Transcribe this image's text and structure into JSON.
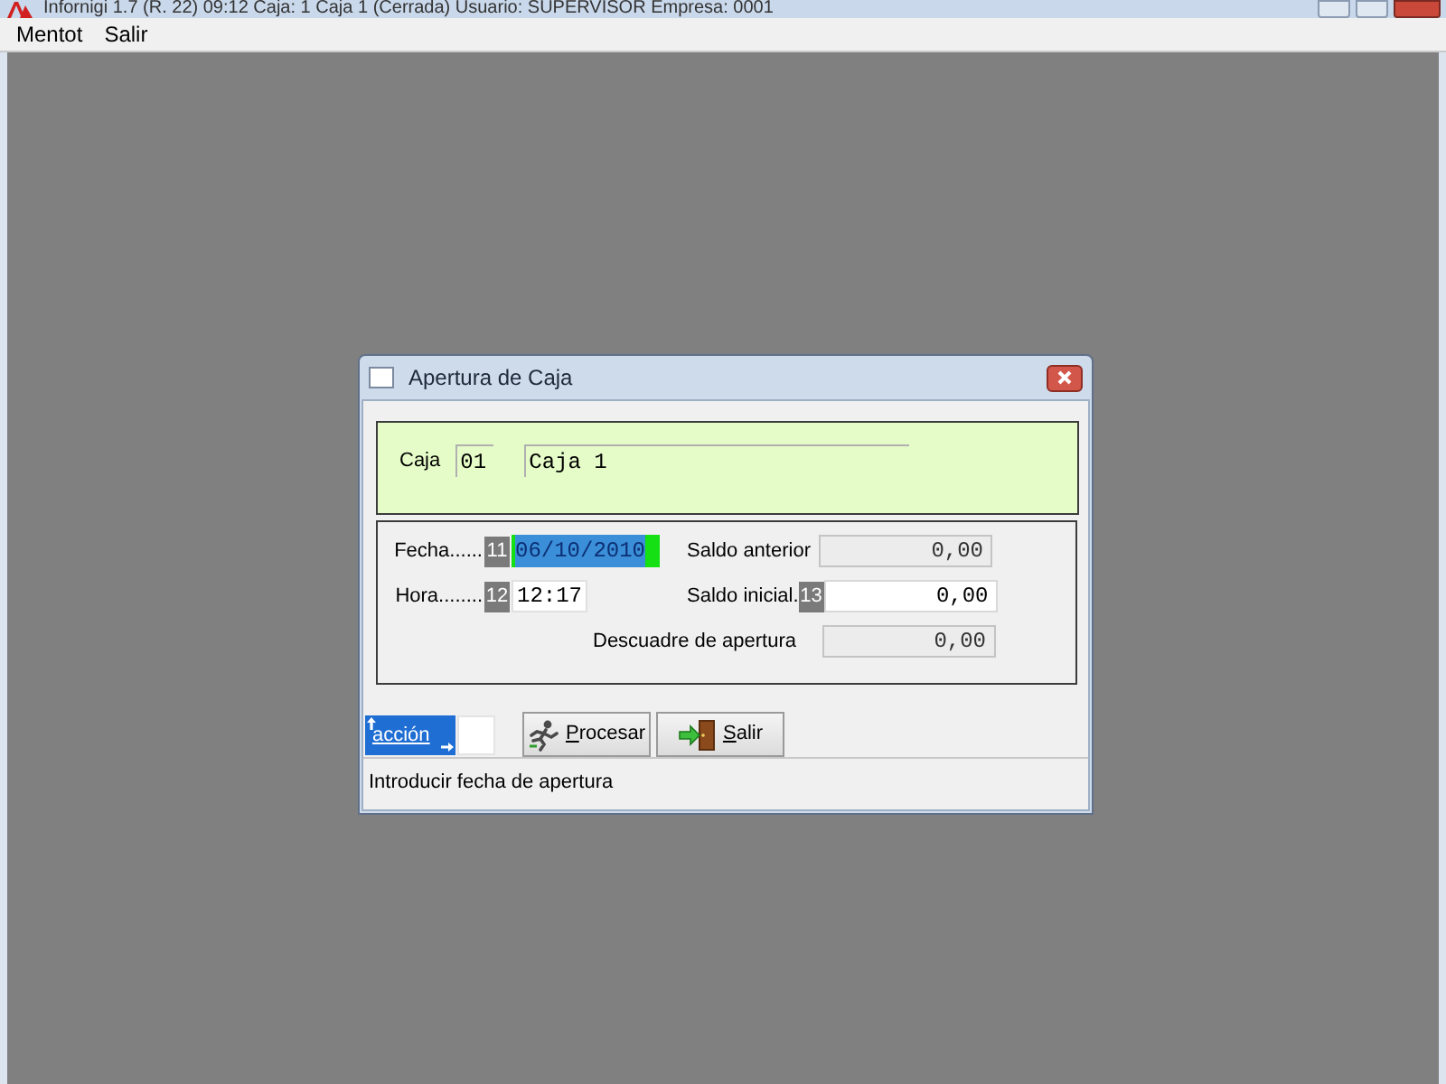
{
  "app_window": {
    "title": "Infornigi 1.7 (R. 22) 09:12 Caja: 1 Caja 1 (Cerrada) Usuario: SUPERVISOR Empresa: 0001"
  },
  "menu": [
    {
      "label": "Mentot"
    },
    {
      "label": "Salir"
    }
  ],
  "dialog": {
    "title": "Apertura de Caja",
    "caja": {
      "label": "Caja",
      "code": "01",
      "name": "Caja 1"
    },
    "left_fields": [
      {
        "label": "Fecha......",
        "badge": "11",
        "value": "06/10/2010",
        "focused": true
      },
      {
        "label": "Hora........",
        "badge": "12",
        "value": "12:17",
        "focused": false
      }
    ],
    "right_fields": [
      {
        "label": "Saldo anterior",
        "value": "0,00",
        "disabled": true
      },
      {
        "label": "Saldo inicial.",
        "badge": "13",
        "value": "0,00",
        "disabled": false
      },
      {
        "label": "Descuadre de apertura",
        "value": "0,00",
        "disabled": true
      }
    ],
    "action": {
      "label": "acción"
    },
    "buttons": [
      {
        "kind": "process",
        "label": "Procesar"
      },
      {
        "kind": "exit",
        "label": "Salir"
      }
    ],
    "status": "Introducir fecha de apertura"
  }
}
